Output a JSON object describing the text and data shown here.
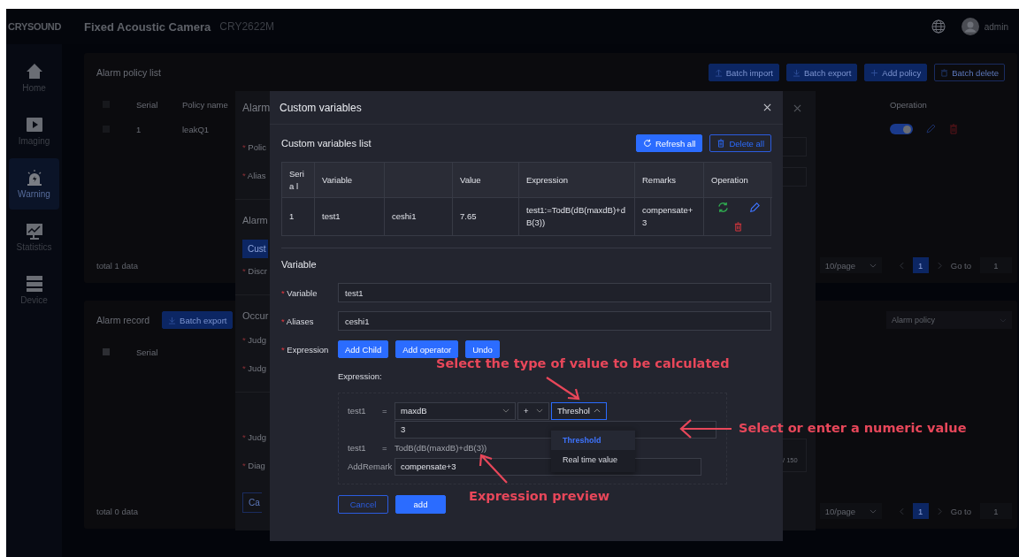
{
  "app": {
    "logo": "CRYSOUND",
    "title": "Fixed Acoustic Camera",
    "model": "CRY2622M",
    "user": "admin"
  },
  "sidebar": [
    {
      "label": "Home",
      "selected": false
    },
    {
      "label": "Imaging",
      "selected": false
    },
    {
      "label": "Warning",
      "selected": true
    },
    {
      "label": "Statistics",
      "selected": false
    },
    {
      "label": "Device",
      "selected": false
    }
  ],
  "policy_card": {
    "title": "Alarm policy list",
    "buttons": [
      {
        "label": "Batch import",
        "kind": "solid"
      },
      {
        "label": "Batch export",
        "kind": "solid"
      },
      {
        "label": "Add policy",
        "kind": "solid"
      },
      {
        "label": "Batch delete",
        "kind": "outline"
      }
    ],
    "columns": [
      "Serial",
      "Policy name",
      "Operation"
    ],
    "header_checked": false,
    "rows": [
      {
        "serial": "1",
        "name": "leakQ1",
        "checked": false,
        "enabled": true
      }
    ],
    "total": "total 1 data",
    "pagination": {
      "page_size": "10/page",
      "pages": [
        {
          "label": "1",
          "selected": true
        }
      ],
      "goto_label": "Go to",
      "goto_value": "1"
    }
  },
  "record_card": {
    "title": "Alarm record",
    "button": "Batch export",
    "filter_placeholder": "Alarm policy",
    "columns": [
      "Serial"
    ],
    "header_checked": false,
    "total": "total 0 data",
    "pagination": {
      "page_size": "10/page",
      "pages": [
        {
          "label": "1",
          "selected": true
        }
      ],
      "goto_label": "Go to",
      "goto_value": "1"
    }
  },
  "policy_dialog": {
    "title": "Alarm",
    "items": [
      {
        "kind": "label",
        "mark": "*",
        "text": "Polic"
      },
      {
        "kind": "label",
        "mark": "*",
        "text": "Alias"
      },
      {
        "kind": "heading",
        "text": "Alarm"
      },
      {
        "kind": "button",
        "text": "Cust"
      },
      {
        "kind": "label",
        "mark": "*",
        "text": "Discr"
      },
      {
        "kind": "heading",
        "text": "Occur"
      },
      {
        "kind": "label",
        "mark": "*",
        "text": "Judg"
      },
      {
        "kind": "label",
        "mark": "*",
        "text": "Judg"
      },
      {
        "kind": "heading"
      },
      {
        "kind": "label",
        "mark": "*",
        "text": "Judg"
      },
      {
        "kind": "label",
        "mark": "*",
        "text": "Diag"
      },
      {
        "kind": "outline",
        "text": "Ca"
      }
    ],
    "counter": "/ 150"
  },
  "variables_dialog": {
    "title": "Custom variables",
    "list_title": "Custom variables list",
    "buttons": [
      {
        "label": "Refresh all",
        "kind": "solid"
      },
      {
        "label": "Delete all",
        "kind": "outline"
      }
    ],
    "columns": [
      "Seria l",
      "Variable",
      "",
      "Value",
      "Expression",
      "Remarks",
      "Operation"
    ],
    "rows": [
      {
        "serial": "1",
        "variable": "test1",
        "alias": "ceshi1",
        "value": "7.65",
        "expression": "test1:=TodB(dB(maxdB)+dB(3))",
        "remarks": "compensate+3"
      }
    ],
    "form_title": "Variable",
    "fields": [
      {
        "label": "Variable",
        "mark": "*",
        "value": "test1"
      },
      {
        "label": "Aliases",
        "mark": "*",
        "value": "ceshi1"
      }
    ],
    "expression": {
      "label": "Expression",
      "mark": "*",
      "buttons": [
        "Add Child",
        "Add operator",
        "Undo"
      ],
      "caption": "Expression:",
      "name": "test1",
      "sign": "=",
      "operand": "maxdB",
      "operator": "+",
      "value_type": "Threshol",
      "value": "3",
      "options": [
        {
          "label": "Threshold",
          "selected": true
        },
        {
          "label": "Real time value",
          "selected": false
        }
      ],
      "preview_name": "test1",
      "preview_sign": "=",
      "preview": "TodB(dB(maxdB)+dB(3))",
      "remark_label": "AddRemark",
      "remark": "compensate+3"
    },
    "actions": [
      {
        "label": "Cancel",
        "kind": "outline"
      },
      {
        "label": "add",
        "kind": "solid"
      }
    ]
  },
  "annotations": [
    {
      "text": "Select the type of value to be calculated"
    },
    {
      "text": "Select or enter a numeric value"
    },
    {
      "text": "Expression preview"
    }
  ]
}
